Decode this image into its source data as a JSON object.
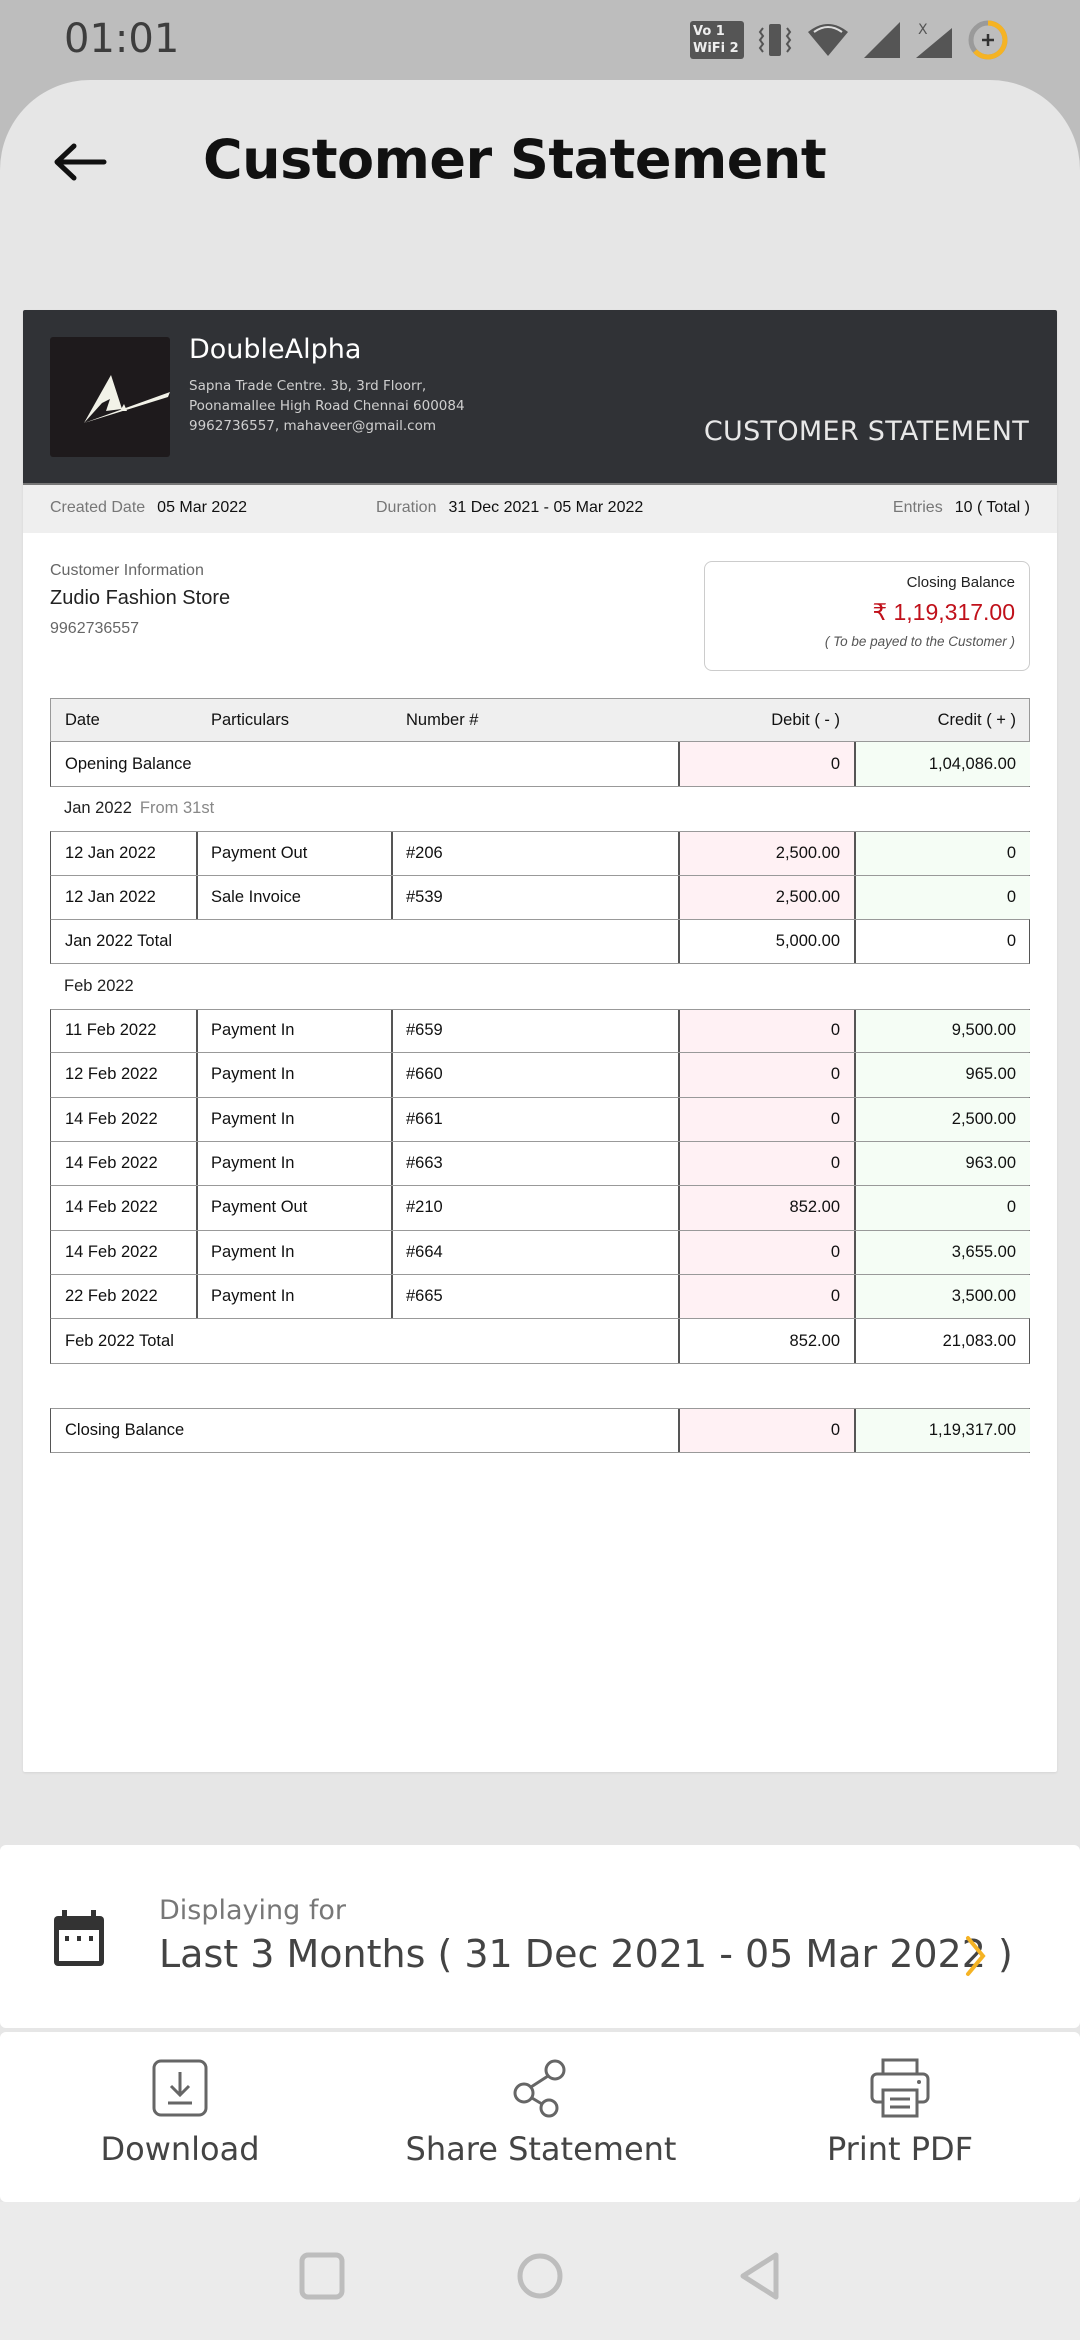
{
  "status_bar": {
    "time": "01:01",
    "vowifi_label_top": "Vo 1",
    "vowifi_label_bottom": "WiFi 2",
    "icons": [
      "vowifi-icon",
      "vibrate-icon",
      "wifi-icon",
      "signal-icon",
      "signal-no-service-icon",
      "battery-saver-icon"
    ]
  },
  "header": {
    "back_icon": "arrow-left-icon",
    "title": "Customer Statement"
  },
  "document": {
    "business": {
      "name": "DoubleAlpha",
      "address_line1": "Sapna Trade Centre. 3b, 3rd Floorr,",
      "address_line2": "Poonamallee High Road Chennai 600084",
      "contact": "9962736557, mahaveer@gmail.com"
    },
    "doc_kind": "CUSTOMER STATEMENT",
    "meta": {
      "created_label": "Created Date",
      "created_value": "05 Mar 2022",
      "duration_label": "Duration",
      "duration_value": "31 Dec 2021 - 05 Mar 2022",
      "entries_label": "Entries",
      "entries_value": "10 ( Total )"
    },
    "customer": {
      "label": "Customer Information",
      "name": "Zudio Fashion Store",
      "phone": "9962736557"
    },
    "closing_card": {
      "title": "Closing Balance",
      "amount": "₹ 1,19,317.00",
      "note": "( To be payed to the Customer )",
      "amount_color": "#c0101a"
    },
    "table": {
      "columns": [
        "Date",
        "Particulars",
        "Number #",
        "Debit ( - )",
        "Credit ( + )"
      ],
      "opening": {
        "label": "Opening Balance",
        "debit": "0",
        "credit": "1,04,086.00"
      },
      "groups": [
        {
          "month": "Jan 2022",
          "sub": "From 31st",
          "rows": [
            {
              "date": "12 Jan 2022",
              "particulars": "Payment Out",
              "number": "#206",
              "debit": "2,500.00",
              "credit": "0"
            },
            {
              "date": "12 Jan 2022",
              "particulars": "Sale Invoice",
              "number": "#539",
              "debit": "2,500.00",
              "credit": "0"
            }
          ],
          "total": {
            "label": "Jan 2022 Total",
            "debit": "5,000.00",
            "credit": "0"
          }
        },
        {
          "month": "Feb 2022",
          "sub": "",
          "rows": [
            {
              "date": "11 Feb 2022",
              "particulars": "Payment In",
              "number": "#659",
              "debit": "0",
              "credit": "9,500.00"
            },
            {
              "date": "12 Feb 2022",
              "particulars": "Payment In",
              "number": "#660",
              "debit": "0",
              "credit": "965.00"
            },
            {
              "date": "14 Feb 2022",
              "particulars": "Payment In",
              "number": "#661",
              "debit": "0",
              "credit": "2,500.00"
            },
            {
              "date": "14 Feb 2022",
              "particulars": "Payment In",
              "number": "#663",
              "debit": "0",
              "credit": "963.00"
            },
            {
              "date": "14 Feb 2022",
              "particulars": "Payment Out",
              "number": "#210",
              "debit": "852.00",
              "credit": "0"
            },
            {
              "date": "14 Feb 2022",
              "particulars": "Payment In",
              "number": "#664",
              "debit": "0",
              "credit": "3,655.00"
            },
            {
              "date": "22 Feb 2022",
              "particulars": "Payment In",
              "number": "#665",
              "debit": "0",
              "credit": "3,500.00"
            }
          ],
          "total": {
            "label": "Feb 2022 Total",
            "debit": "852.00",
            "credit": "21,083.00"
          }
        }
      ],
      "closing": {
        "label": "Closing Balance",
        "debit": "0",
        "credit": "1,19,317.00"
      }
    }
  },
  "filter": {
    "icon": "calendar-icon",
    "label": "Displaying for",
    "value": "Last 3 Months ( 31 Dec 2021 - 05 Mar 2022 )",
    "chevron_icon": "chevron-right-icon",
    "accent": "#f5b324"
  },
  "actions": [
    {
      "icon": "download-icon",
      "label": "Download"
    },
    {
      "icon": "share-icon",
      "label": "Share Statement"
    },
    {
      "icon": "printer-icon",
      "label": "Print PDF"
    }
  ],
  "nav": [
    "recents-icon",
    "home-icon",
    "back-icon"
  ]
}
